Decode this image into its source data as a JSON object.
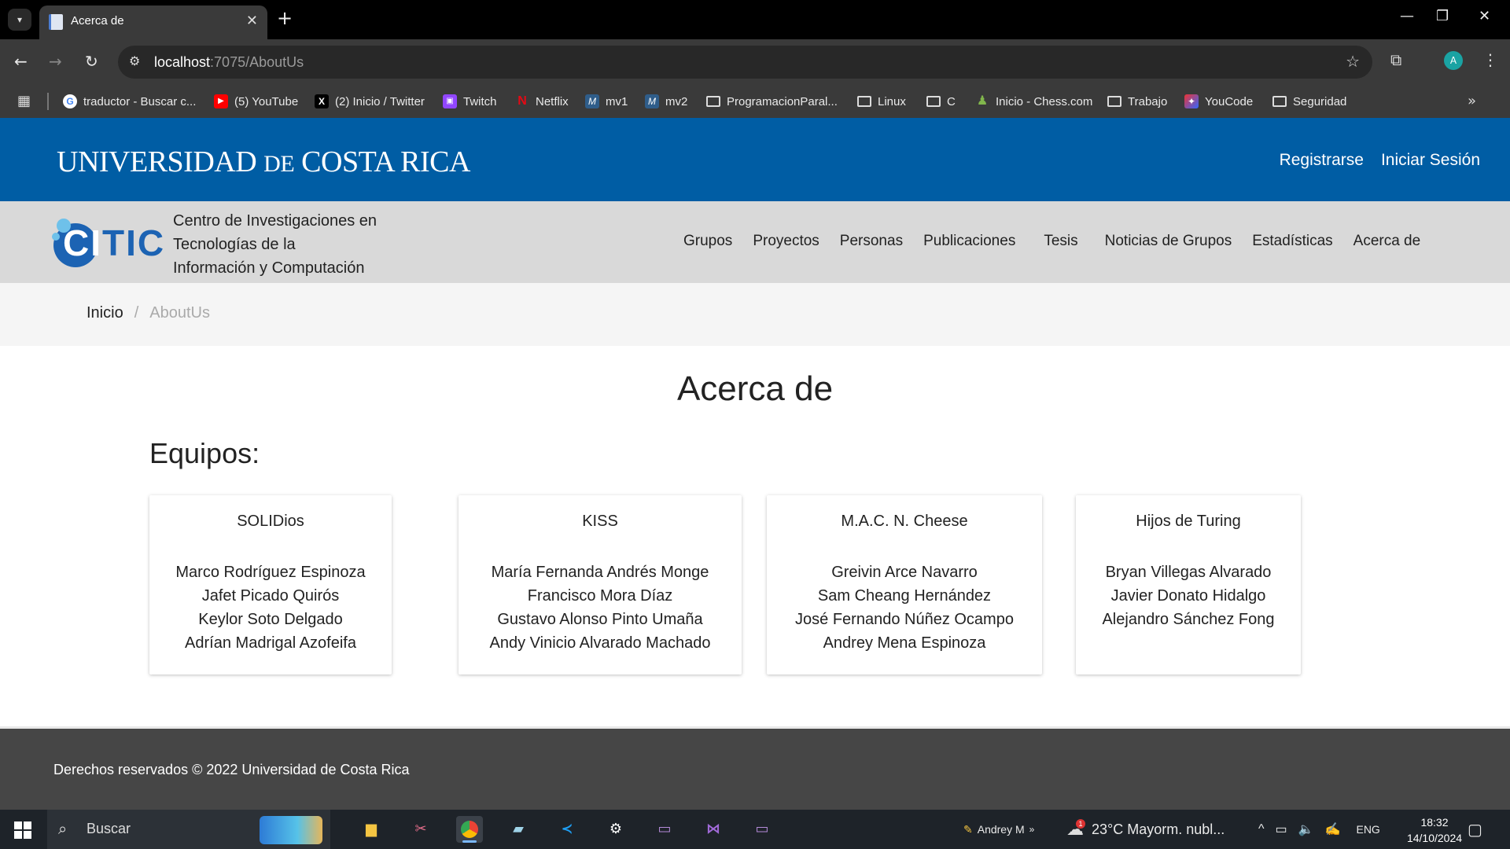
{
  "browser": {
    "tab_title": "Acerca de",
    "url_host": "localhost",
    "url_rest": ":7075/AboutUs",
    "profile_initial": "A",
    "bookmarks": [
      {
        "label": "traductor - Buscar c...",
        "icon": "google-icon"
      },
      {
        "label": "(5) YouTube",
        "icon": "youtube-icon"
      },
      {
        "label": "(2) Inicio / Twitter",
        "icon": "x-icon"
      },
      {
        "label": "Twitch",
        "icon": "twitch-icon"
      },
      {
        "label": "Netflix",
        "icon": "netflix-icon"
      },
      {
        "label": "mv1",
        "icon": "m-icon"
      },
      {
        "label": "mv2",
        "icon": "m-icon"
      },
      {
        "label": "ProgramacionParal...",
        "icon": "folder-icon"
      },
      {
        "label": "Linux",
        "icon": "folder-icon"
      },
      {
        "label": "C",
        "icon": "folder-icon"
      },
      {
        "label": "Inicio - Chess.com",
        "icon": "chess-icon"
      },
      {
        "label": "Trabajo",
        "icon": "folder-icon"
      },
      {
        "label": "YouCode",
        "icon": "youcode-icon"
      },
      {
        "label": "Seguridad",
        "icon": "folder-icon"
      }
    ]
  },
  "header": {
    "logo_text_1": "UNIVERSIDAD",
    "logo_text_2": "DE",
    "logo_text_3": "COSTA RICA",
    "register": "Registrarse",
    "login": "Iniciar Sesión"
  },
  "citic": {
    "logo_ci": "CI",
    "logo_tic": "TIC",
    "name_line1": "Centro de Investigaciones en",
    "name_line2": "Tecnologías de la",
    "name_line3": "Información y Computación",
    "nav": [
      "Grupos",
      "Proyectos",
      "Personas",
      "Publicaciones",
      "Tesis",
      "Noticias de Grupos",
      "Estadísticas",
      "Acerca de"
    ]
  },
  "breadcrumb": {
    "home": "Inicio",
    "separator": "/",
    "current": "AboutUs"
  },
  "main": {
    "title": "Acerca de",
    "section_title": "Equipos:",
    "teams": [
      {
        "name": "SOLIDios",
        "members": [
          "Marco Rodríguez Espinoza",
          "Jafet Picado Quirós",
          "Keylor Soto Delgado",
          "Adrían Madrigal Azofeifa"
        ]
      },
      {
        "name": "KISS",
        "members": [
          "María Fernanda Andrés Monge",
          "Francisco Mora Díaz",
          "Gustavo Alonso Pinto Umaña",
          "Andy Vinicio Alvarado Machado"
        ]
      },
      {
        "name": "M.A.C. N. Cheese",
        "members": [
          "Greivin Arce Navarro",
          "Sam Cheang Hernández",
          "José Fernando Núñez Ocampo",
          "Andrey Mena Espinoza"
        ]
      },
      {
        "name": "Hijos de Turing",
        "members": [
          "Bryan Villegas Alvarado",
          "Javier Donato Hidalgo",
          "Alejandro Sánchez Fong"
        ]
      }
    ]
  },
  "footer": {
    "text": "Derechos reservados © 2022 Universidad de Costa Rica"
  },
  "taskbar": {
    "search_placeholder": "Buscar",
    "user_name": "Andrey M",
    "weather": "23°C  Mayorm. nubl...",
    "language": "ENG",
    "time": "18:32",
    "date": "14/10/2024",
    "weather_badge": "1"
  },
  "colors": {
    "ucr_blue": "#005da4",
    "citic_bar": "#d9d9d9",
    "footer": "#464646"
  }
}
